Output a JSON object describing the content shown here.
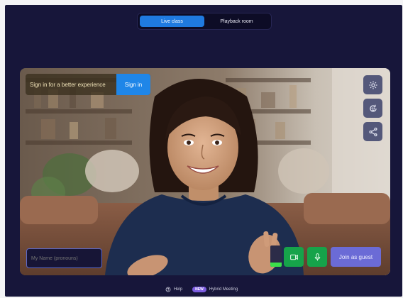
{
  "mode_toggle": {
    "tabs": [
      {
        "label": "Live class",
        "active": true
      },
      {
        "label": "Playback room",
        "active": false
      }
    ]
  },
  "signin": {
    "message": "Sign in for a better experience",
    "button_label": "Sign in"
  },
  "side_controls": {
    "icons": [
      "settings-icon",
      "face-refresh-icon",
      "share-icon"
    ]
  },
  "join": {
    "name_placeholder": "My Name (pronouns)",
    "button_label": "Join as guest",
    "mic_level_pct": 20,
    "camera_icon": "camera-icon",
    "mic_icon": "mic-icon"
  },
  "footer": {
    "help_label": "Help",
    "badge_label": "NEW",
    "hybrid_label": "Hybrid Meeting"
  },
  "colors": {
    "background": "#17163a",
    "accent_blue": "#1f7ae0",
    "control_green": "#16a34a",
    "join_purple": "#6b6bd6",
    "badge_purple": "#7c5ce0"
  }
}
